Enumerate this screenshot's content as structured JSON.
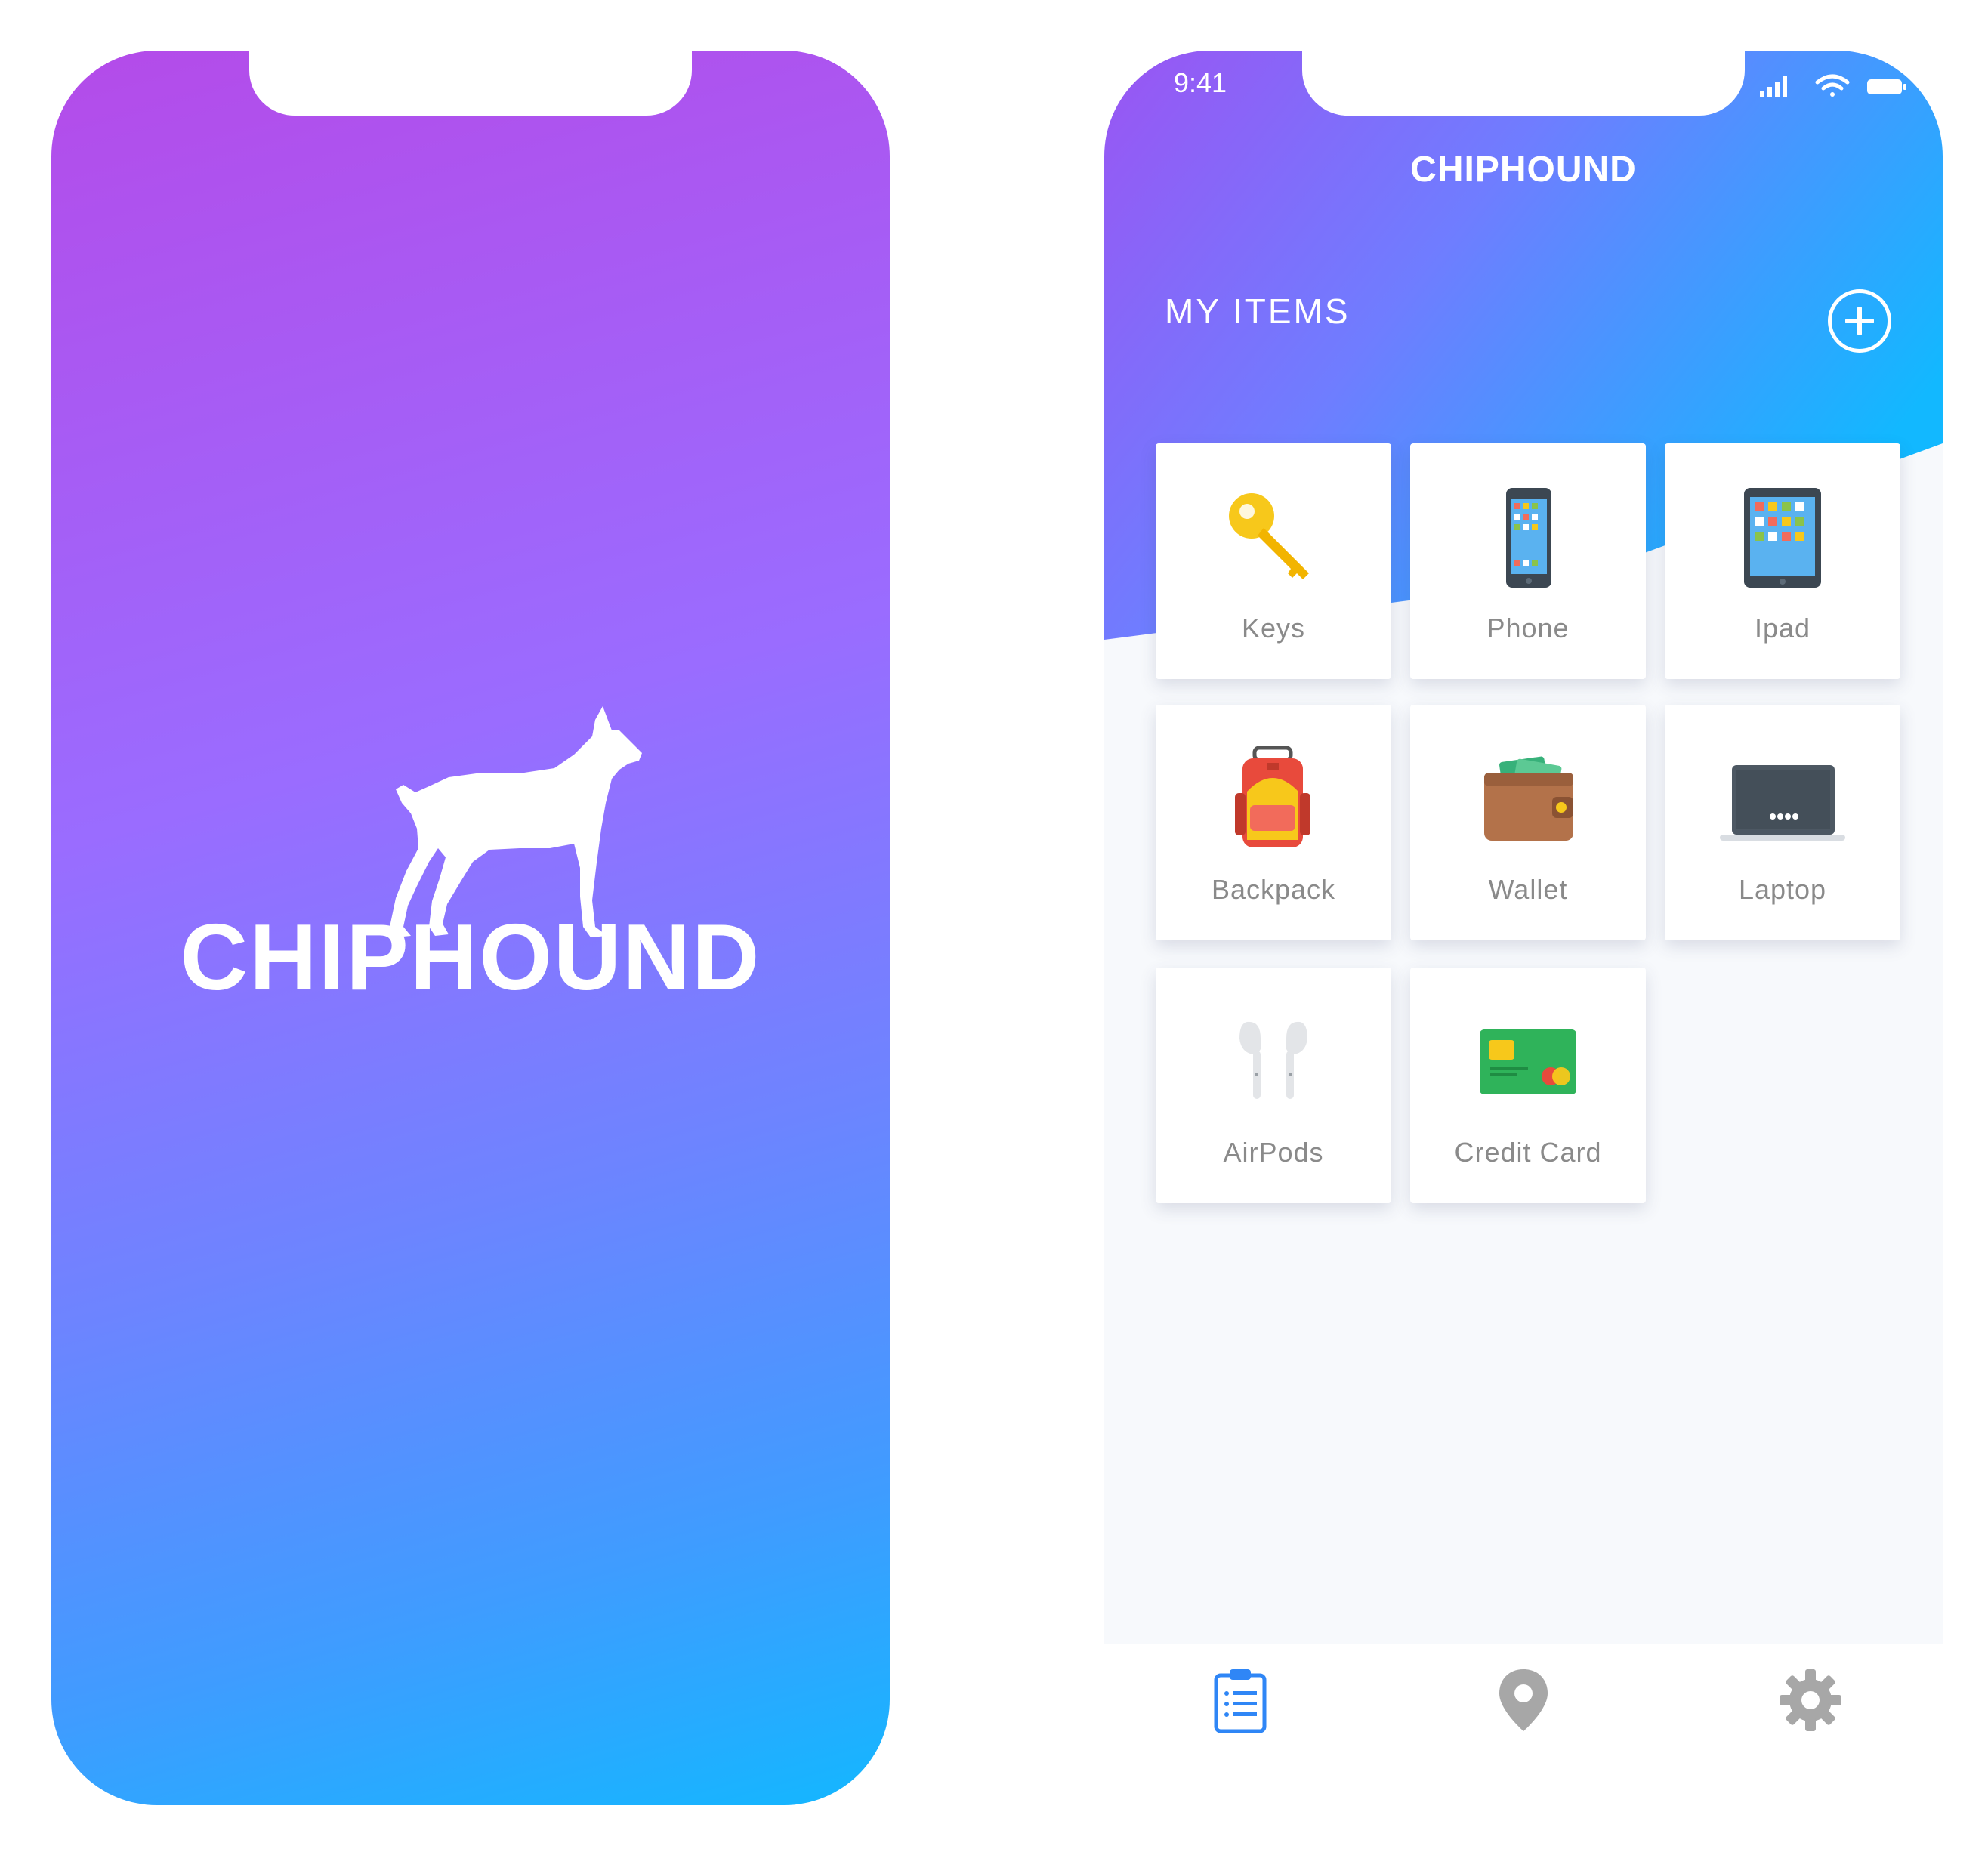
{
  "splash": {
    "brand": "CHIPHOUND",
    "gradient_colors": [
      "#b44be9",
      "#9a6cff",
      "#6d84ff",
      "#13b7ff"
    ],
    "logo_icon": "boxer-dog-icon"
  },
  "app": {
    "status_bar": {
      "time": "9:41",
      "icons": [
        "signal-icon",
        "wifi-icon",
        "battery-icon"
      ]
    },
    "title": "CHIPHOUND",
    "section_title": "MY ITEMS",
    "add_icon": "plus-circle-icon",
    "items": [
      {
        "label": "Keys",
        "icon": "key-icon"
      },
      {
        "label": "Phone",
        "icon": "phone-icon"
      },
      {
        "label": "Ipad",
        "icon": "tablet-icon"
      },
      {
        "label": "Backpack",
        "icon": "backpack-icon"
      },
      {
        "label": "Wallet",
        "icon": "wallet-icon"
      },
      {
        "label": "Laptop",
        "icon": "laptop-icon"
      },
      {
        "label": "AirPods",
        "icon": "airpods-icon"
      },
      {
        "label": "Credit Card",
        "icon": "credit-card-icon"
      }
    ],
    "tabs": [
      {
        "name": "items",
        "icon": "clipboard-icon",
        "active": true,
        "color": "#2f86f6"
      },
      {
        "name": "map",
        "icon": "location-pin-icon",
        "active": false,
        "color": "#a7a7a7"
      },
      {
        "name": "settings",
        "icon": "gear-icon",
        "active": false,
        "color": "#a7a7a7"
      }
    ]
  }
}
